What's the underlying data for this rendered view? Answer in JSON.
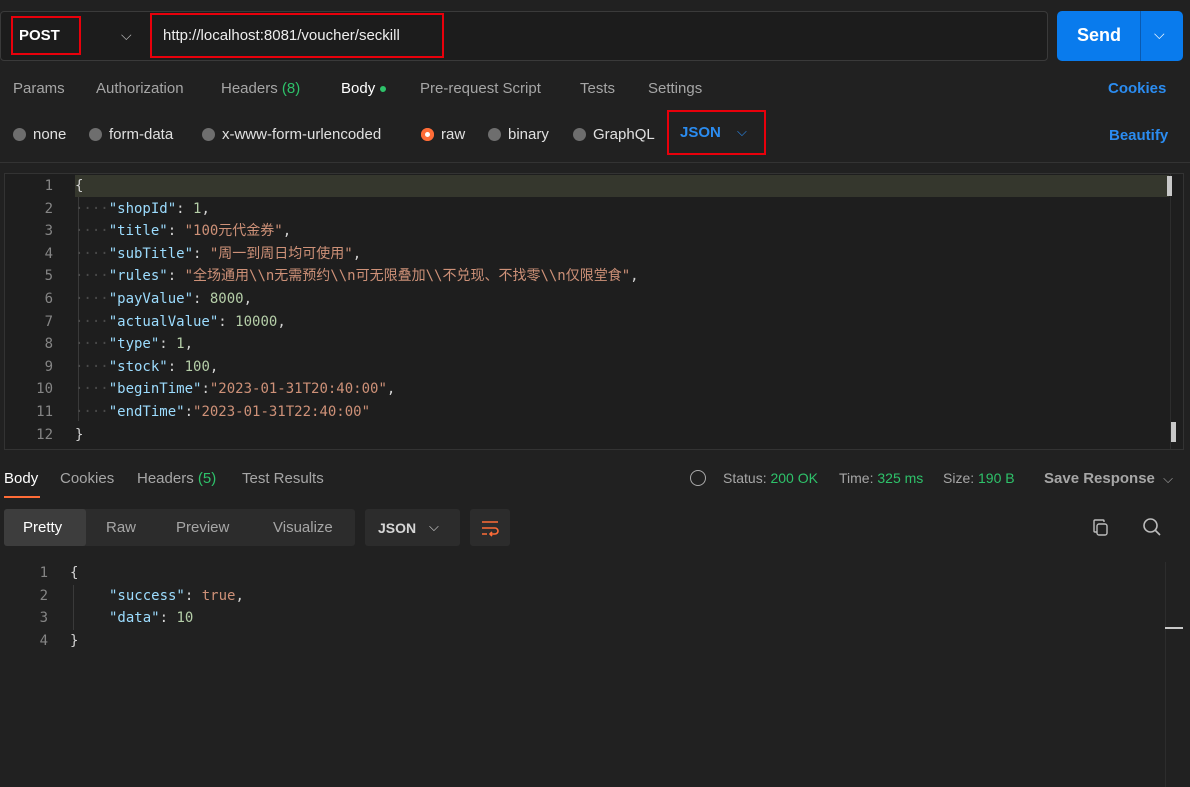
{
  "request": {
    "method": "POST",
    "url": "http://localhost:8081/voucher/seckill",
    "send_label": "Send"
  },
  "tabs": {
    "params": "Params",
    "authorization": "Authorization",
    "headers": "Headers",
    "headers_count": "(8)",
    "body": "Body",
    "pre_request": "Pre-request Script",
    "tests": "Tests",
    "settings": "Settings",
    "cookies": "Cookies"
  },
  "body_types": {
    "none": "none",
    "form_data": "form-data",
    "urlencoded": "x-www-form-urlencoded",
    "raw": "raw",
    "binary": "binary",
    "graphql": "GraphQL",
    "format": "JSON",
    "beautify": "Beautify",
    "selected": "raw"
  },
  "editor": {
    "line_numbers": [
      "1",
      "2",
      "3",
      "4",
      "5",
      "6",
      "7",
      "8",
      "9",
      "10",
      "11",
      "12"
    ],
    "open_brace": "{",
    "close_brace": "}",
    "entries": [
      {
        "key": "\"shopId\"",
        "sep": ": ",
        "value": "1",
        "type": "num",
        "comma": ","
      },
      {
        "key": "\"title\"",
        "sep": ": ",
        "value": "\"100元代金券\"",
        "type": "str",
        "comma": ","
      },
      {
        "key": "\"subTitle\"",
        "sep": ": ",
        "value": "\"周一到周日均可使用\"",
        "type": "str",
        "comma": ","
      },
      {
        "key": "\"rules\"",
        "sep": ": ",
        "value": "\"全场通用\\\\n无需预约\\\\n可无限叠加\\\\不兑现、不找零\\\\n仅限堂食\"",
        "type": "str",
        "comma": ","
      },
      {
        "key": "\"payValue\"",
        "sep": ": ",
        "value": "8000",
        "type": "num",
        "comma": ","
      },
      {
        "key": "\"actualValue\"",
        "sep": ": ",
        "value": "10000",
        "type": "num",
        "comma": ","
      },
      {
        "key": "\"type\"",
        "sep": ": ",
        "value": "1",
        "type": "num",
        "comma": ","
      },
      {
        "key": "\"stock\"",
        "sep": ": ",
        "value": "100",
        "type": "num",
        "comma": ","
      },
      {
        "key": "\"beginTime\"",
        "sep": ":",
        "value": "\"2023-01-31T20:40:00\"",
        "type": "str",
        "comma": ","
      },
      {
        "key": "\"endTime\"",
        "sep": ":",
        "value": "\"2023-01-31T22:40:00\"",
        "type": "str",
        "comma": ""
      }
    ]
  },
  "response": {
    "tabs": {
      "body": "Body",
      "cookies": "Cookies",
      "headers": "Headers",
      "headers_count": "(5)",
      "test_results": "Test Results"
    },
    "status_label": "Status:",
    "status_value": "200 OK",
    "time_label": "Time:",
    "time_value": "325 ms",
    "size_label": "Size:",
    "size_value": "190 B",
    "save_response": "Save Response",
    "views": {
      "pretty": "Pretty",
      "raw": "Raw",
      "preview": "Preview",
      "visualize": "Visualize"
    },
    "format": "JSON",
    "line_numbers": [
      "1",
      "2",
      "3",
      "4"
    ],
    "open_brace": "{",
    "close_brace": "}",
    "success_key": "\"success\"",
    "success_value": "true",
    "data_key": "\"data\"",
    "data_value": "10"
  },
  "colors": {
    "accent": "#ff6c37",
    "primary_blue": "#097bed",
    "status_green": "#2ec26a",
    "highlight_red": "#e8000b"
  }
}
